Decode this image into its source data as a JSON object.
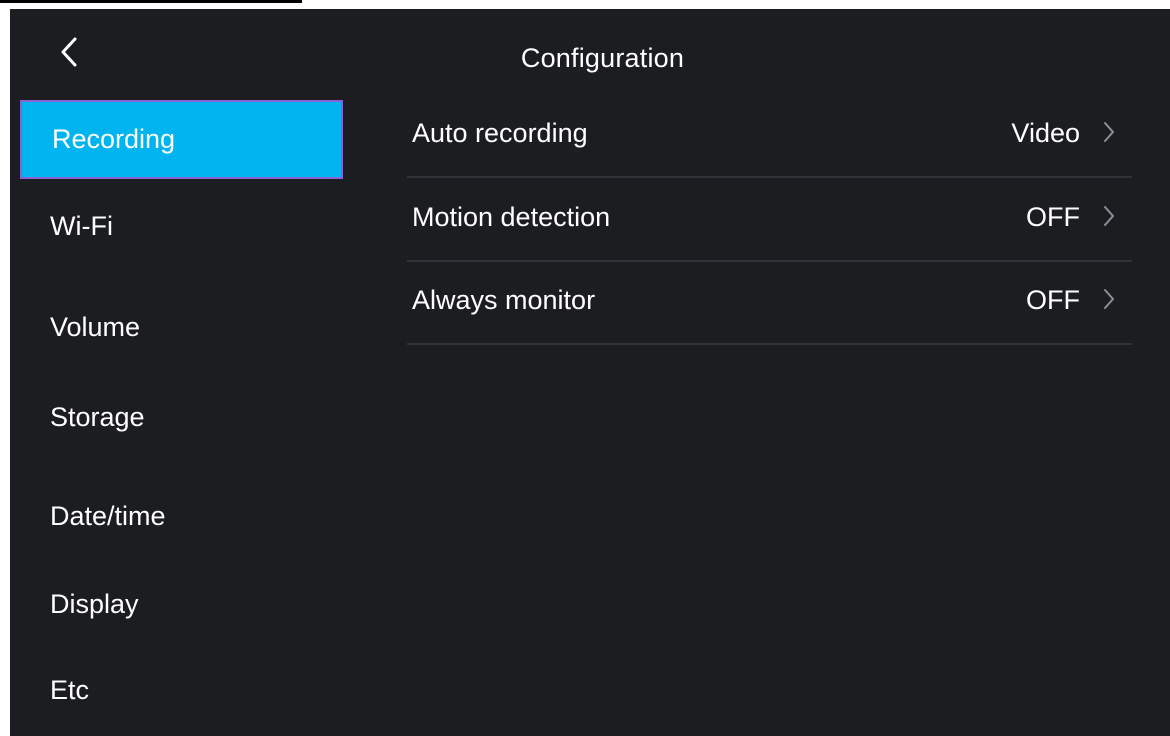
{
  "header": {
    "title": "Configuration",
    "back_icon": "chevron-left-icon"
  },
  "sidebar": {
    "items": [
      {
        "label": "Recording",
        "active": true
      },
      {
        "label": "Wi-Fi",
        "active": false
      },
      {
        "label": "Volume",
        "active": false
      },
      {
        "label": "Storage",
        "active": false
      },
      {
        "label": "Date/time",
        "active": false
      },
      {
        "label": "Display",
        "active": false
      },
      {
        "label": "Etc",
        "active": false
      }
    ]
  },
  "settings": {
    "rows": [
      {
        "label": "Auto recording",
        "value": "Video"
      },
      {
        "label": "Motion detection",
        "value": "OFF"
      },
      {
        "label": "Always monitor",
        "value": "OFF"
      }
    ],
    "chevron_icon": "chevron-right-icon"
  },
  "colors": {
    "background": "#1b1d20",
    "accent": "#00b4ef",
    "active_border": "#8a63d2",
    "divider": "#2f3338"
  }
}
